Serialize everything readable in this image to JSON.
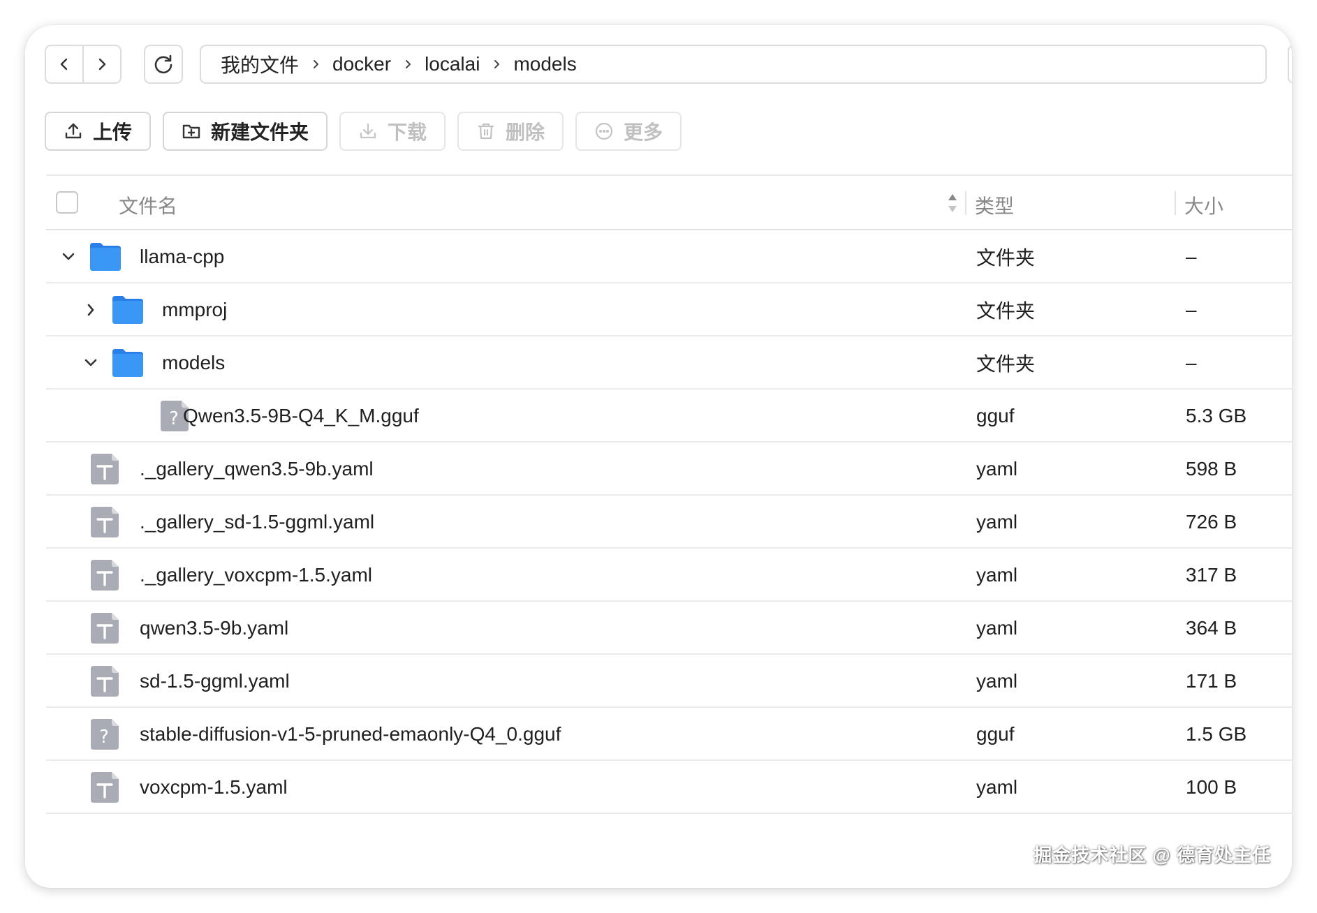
{
  "breadcrumb": {
    "items": [
      "我的文件",
      "docker",
      "localai",
      "models"
    ]
  },
  "toolbar": {
    "upload": "上传",
    "new_folder": "新建文件夹",
    "download": "下载",
    "delete": "删除",
    "more": "更多"
  },
  "table": {
    "headers": {
      "name": "文件名",
      "type": "类型",
      "size": "大小"
    },
    "rows": [
      {
        "name": "llama-cpp",
        "type": "文件夹",
        "size": "–",
        "kind": "folder",
        "depth": 0,
        "expander": "expanded"
      },
      {
        "name": "mmproj",
        "type": "文件夹",
        "size": "–",
        "kind": "folder",
        "depth": 1,
        "expander": "collapsed"
      },
      {
        "name": "models",
        "type": "文件夹",
        "size": "–",
        "kind": "folder",
        "depth": 1,
        "expander": "expanded"
      },
      {
        "name": "Qwen3.5-9B-Q4_K_M.gguf",
        "type": "gguf",
        "size": "5.3 GB",
        "kind": "unknown-file",
        "depth": 2,
        "expander": "none"
      },
      {
        "name": "._gallery_qwen3.5-9b.yaml",
        "type": "yaml",
        "size": "598 B",
        "kind": "text-file",
        "depth": 0,
        "expander": "none"
      },
      {
        "name": "._gallery_sd-1.5-ggml.yaml",
        "type": "yaml",
        "size": "726 B",
        "kind": "text-file",
        "depth": 0,
        "expander": "none"
      },
      {
        "name": "._gallery_voxcpm-1.5.yaml",
        "type": "yaml",
        "size": "317 B",
        "kind": "text-file",
        "depth": 0,
        "expander": "none"
      },
      {
        "name": "qwen3.5-9b.yaml",
        "type": "yaml",
        "size": "364 B",
        "kind": "text-file",
        "depth": 0,
        "expander": "none"
      },
      {
        "name": "sd-1.5-ggml.yaml",
        "type": "yaml",
        "size": "171 B",
        "kind": "text-file",
        "depth": 0,
        "expander": "none"
      },
      {
        "name": "stable-diffusion-v1-5-pruned-emaonly-Q4_0.gguf",
        "type": "gguf",
        "size": "1.5 GB",
        "kind": "unknown-file",
        "depth": 0,
        "expander": "none"
      },
      {
        "name": "voxcpm-1.5.yaml",
        "type": "yaml",
        "size": "100 B",
        "kind": "text-file",
        "depth": 0,
        "expander": "none"
      }
    ]
  },
  "watermark": "掘金技术社区 @ 德育处主任",
  "colors": {
    "folder": "#2f8cf0",
    "file_icon": "#a6a9b2",
    "border": "#dcdcdc",
    "disabled_text": "#c0c0c0"
  }
}
